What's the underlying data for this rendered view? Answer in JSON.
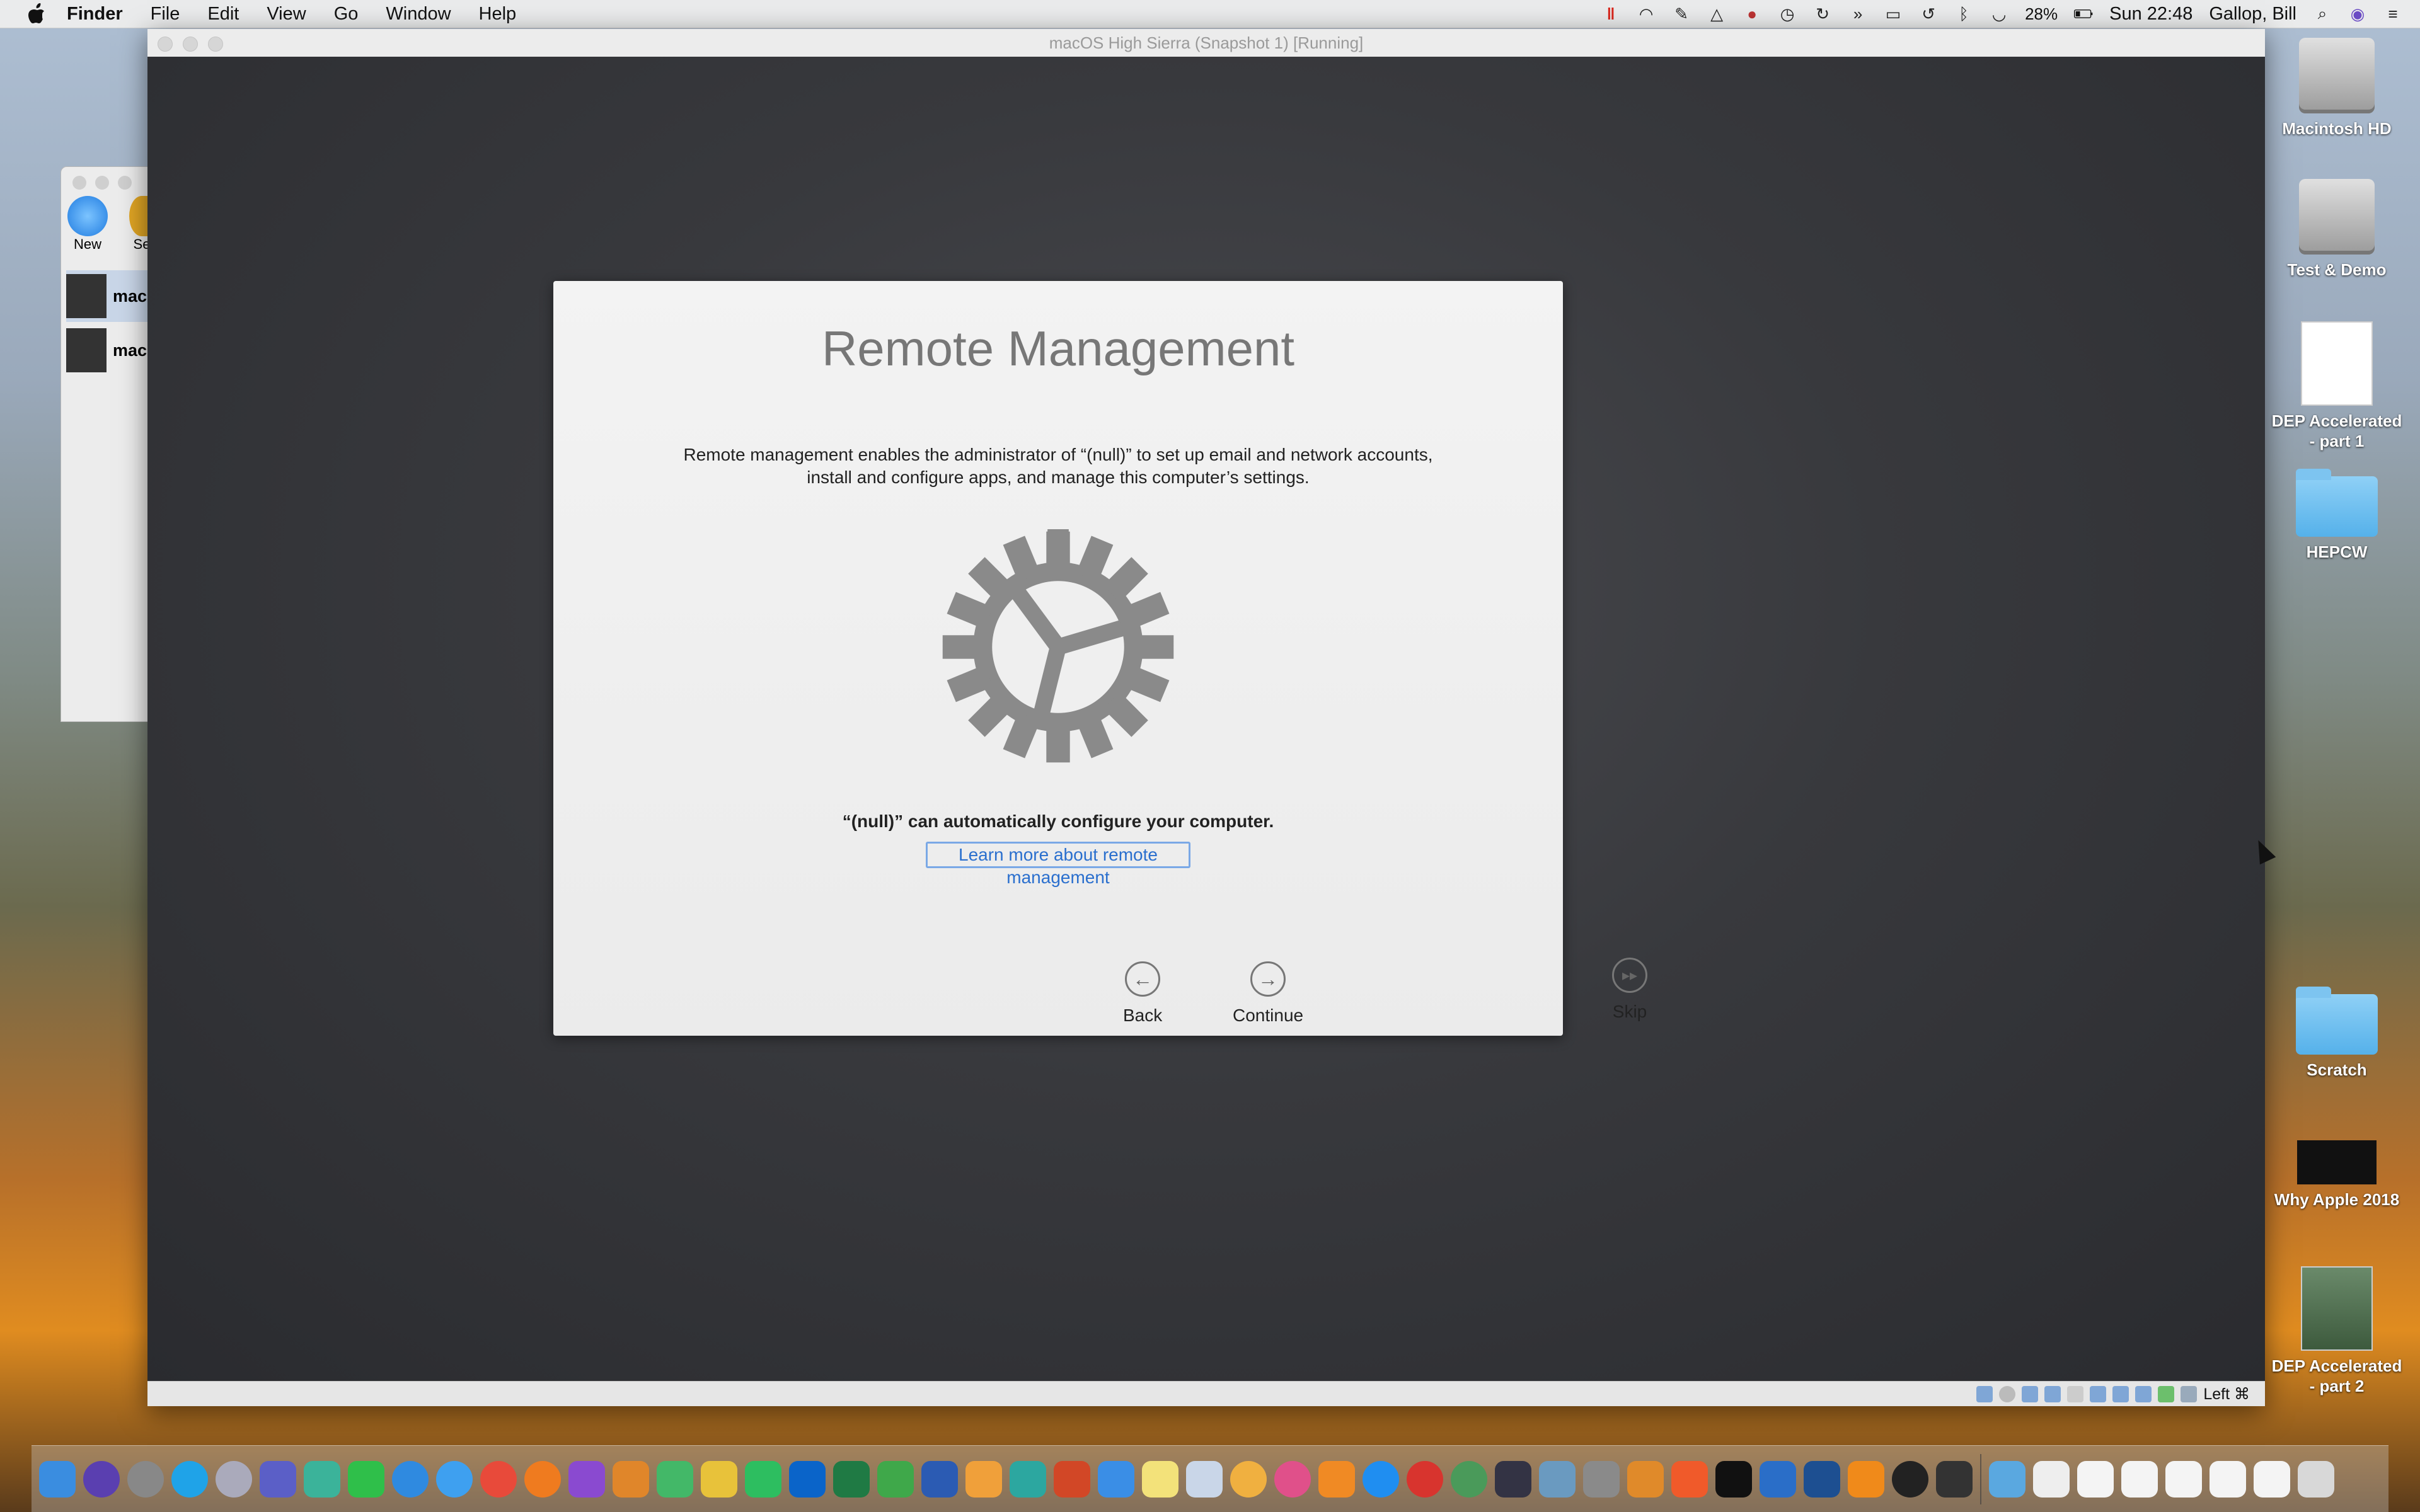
{
  "menubar": {
    "apple_icon": "apple-icon",
    "app": "Finder",
    "items": [
      "File",
      "Edit",
      "View",
      "Go",
      "Window",
      "Help"
    ],
    "battery": "28%",
    "clock": "Sun 22:48",
    "user": "Gallop, Bill"
  },
  "vbox_manager": {
    "tools": [
      {
        "label": "New"
      },
      {
        "label": "Se"
      }
    ],
    "vms": [
      {
        "name": "mac"
      },
      {
        "name": "mac"
      }
    ]
  },
  "vm_window": {
    "title": "macOS High Sierra (Snapshot 1) [Running]",
    "host_key": "Left ⌘"
  },
  "dialog": {
    "title": "Remote Management",
    "description_line1": "Remote management enables the administrator of “(null)” to set up email and network accounts,",
    "description_line2": "install and configure apps, and manage this computer’s settings.",
    "auto_config": "“(null)” can automatically configure your computer.",
    "learn_more": "Learn more about remote management",
    "back": "Back",
    "continue": "Continue",
    "skip": "Skip"
  },
  "desktop": {
    "items": [
      {
        "label": "Macintosh HD"
      },
      {
        "label": "Test & Demo"
      },
      {
        "label": "DEP Accelerated - part 1"
      },
      {
        "label": "HEPCW"
      },
      {
        "label": "Scratch"
      },
      {
        "label": "Why Apple 2018"
      },
      {
        "label": "DEP Accelerated - part 2"
      }
    ]
  },
  "dock": {
    "apps": [
      "Finder",
      "Siri",
      "System Preferences",
      "Skype",
      "Launchpad",
      "Teams",
      "Pinwheel",
      "FaceTime",
      "Safari",
      "Messages",
      "Chrome",
      "Firefox",
      "OmniFocus",
      "Sublime",
      "Maps",
      "Evernote",
      "Outlook",
      "Excel",
      "Numbers",
      "Word",
      "Pages",
      "Notes",
      "PowerPoint",
      "Keynote",
      "Stickies",
      "Preview",
      "Photos",
      "iTunes",
      "iBooks",
      "App Store",
      "Self Service",
      "Network",
      "Jamf",
      "Console",
      "Automator",
      "Terminal",
      "VMware",
      "VirtualBox",
      "Migration",
      "Screens"
    ]
  }
}
